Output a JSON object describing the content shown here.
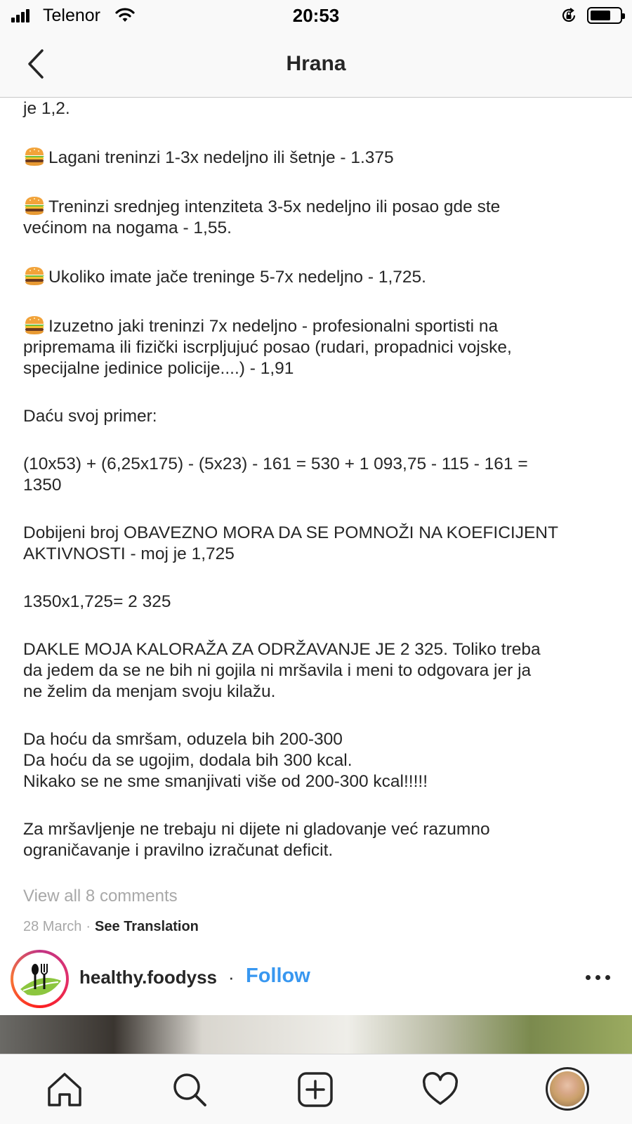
{
  "status_bar": {
    "carrier": "Telenor",
    "time": "20:53"
  },
  "header": {
    "title": "Hrana"
  },
  "caption": {
    "paragraphs": [
      {
        "lines": [
          "je 1,2."
        ]
      },
      {
        "emoji": "hamburger-icon",
        "lines": [
          "Lagani treninzi 1-3x nedeljno ili šetnje -  1.375"
        ]
      },
      {
        "emoji": "hamburger-icon",
        "lines": [
          "Treninzi srednjeg intenziteta 3-5x nedeljno ili posao gde ste",
          "većinom na nogama - 1,55."
        ]
      },
      {
        "emoji": "hamburger-icon",
        "lines": [
          "Ukoliko imate jače treninge 5-7x nedeljno - 1,725."
        ]
      },
      {
        "emoji": "hamburger-icon",
        "lines": [
          "Izuzetno jaki treninzi 7x nedeljno - profesionalni sportisti na",
          "pripremama ili fizički iscrpljujuć posao (rudari, propadnici vojske,",
          "specijalne jedinice policije....) - 1,91"
        ]
      },
      {
        "lines": [
          "Daću svoj primer:"
        ]
      },
      {
        "lines": [
          "(10x53) + (6,25x175) - (5x23) - 161 = 530 + 1 093,75 - 115 - 161 =",
          "1350"
        ]
      },
      {
        "lines": [
          "Dobijeni broj OBAVEZNO MORA DA SE POMNOŽI NA KOEFICIJENT",
          "AKTIVNOSTI - moj je 1,725"
        ]
      },
      {
        "lines": [
          "1350x1,725= 2 325"
        ]
      },
      {
        "lines": [
          "DAKLE MOJA KALORAŽA ZA ODRŽAVANJE JE 2 325. Toliko treba",
          "da jedem da se ne bih ni gojila ni mršavila i meni to odgovara jer ja",
          "ne želim da menjam svoju kilažu."
        ]
      },
      {
        "lines": [
          "Da hoću da smršam, oduzela bih 200-300",
          "Da hoću da se ugojim, dodala bih 300 kcal.",
          "Nikako se ne sme smanjivati više od 200-300 kcal!!!!!"
        ]
      },
      {
        "lines": [
          "Za mršavljenje ne trebaju ni dijete ni gladovanje već razumno",
          "ograničavanje i pravilno izračunat deficit."
        ]
      }
    ]
  },
  "comments": {
    "view_all": "View all 8 comments"
  },
  "meta": {
    "date": "28 March",
    "separator": "·",
    "see_translation": "See Translation"
  },
  "next_post": {
    "username": "healthy.foodyss",
    "separator": "·",
    "follow": "Follow"
  },
  "tab_bar": {
    "tabs": [
      "home-icon",
      "search-icon",
      "new-post-icon",
      "activity-heart-icon",
      "profile-avatar"
    ]
  },
  "colors": {
    "accent": "#3897f0",
    "text": "#262626",
    "muted": "#a8a8a8",
    "bar_bg": "#f9f9f9"
  }
}
